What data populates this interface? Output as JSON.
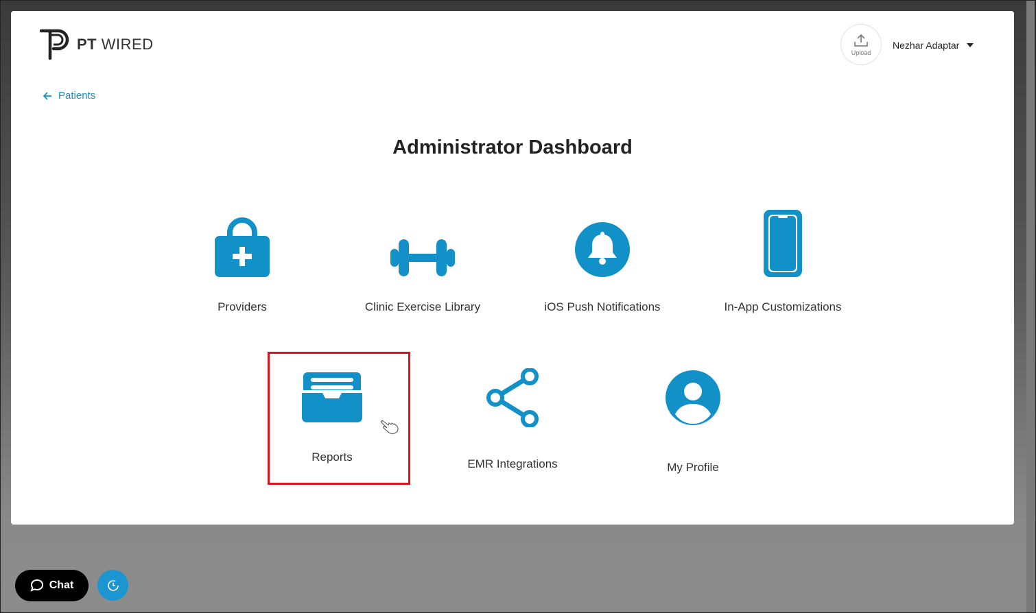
{
  "brand": {
    "bold": "PT",
    "light": "WIRED",
    "icon": "pt-wired-logo-icon"
  },
  "header": {
    "upload_label": "Upload",
    "upload_icon": "upload-icon",
    "user_name": "Nezhar Adaptar",
    "user_menu_icon": "caret-down-icon"
  },
  "nav": {
    "back_label": "Patients",
    "back_icon": "arrow-left-icon"
  },
  "page": {
    "title": "Administrator Dashboard"
  },
  "tiles": [
    {
      "label": "Providers",
      "icon": "medical-bag-icon"
    },
    {
      "label": "Clinic Exercise Library",
      "icon": "dumbbell-icon"
    },
    {
      "label": "iOS Push Notifications",
      "icon": "bell-icon"
    },
    {
      "label": "In-App Customizations",
      "icon": "smartphone-icon"
    },
    {
      "label": "Reports",
      "icon": "inbox-tray-icon",
      "highlighted": true
    },
    {
      "label": "EMR Integrations",
      "icon": "share-icon"
    },
    {
      "label": "My Profile",
      "icon": "user-circle-icon"
    }
  ],
  "footer": {
    "chat_label": "Chat",
    "chat_icon": "chat-bubble-icon",
    "history_icon": "clock-history-icon"
  },
  "colors": {
    "accent": "#1290C8",
    "highlight": "#D9141C",
    "title": "#222222"
  }
}
